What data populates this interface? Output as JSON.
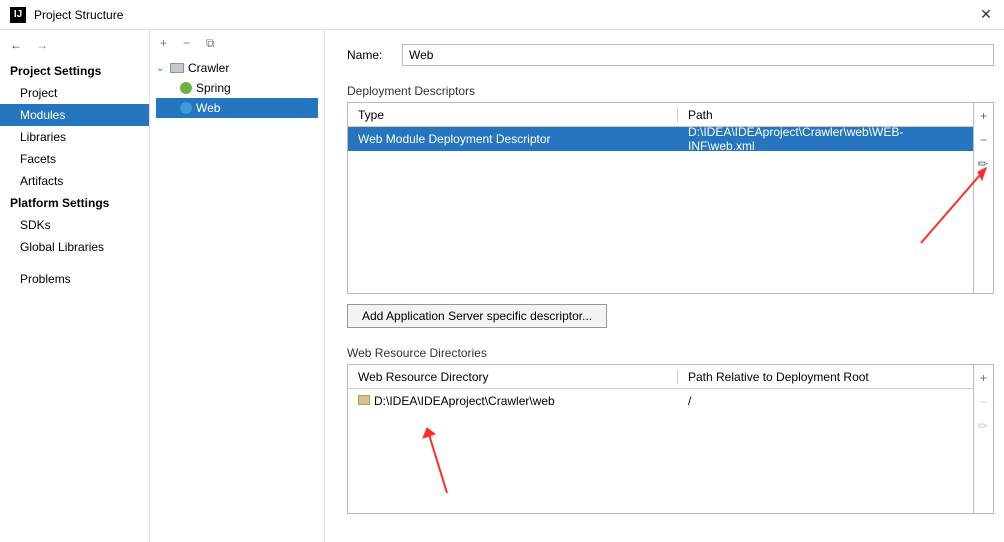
{
  "window": {
    "title": "Project Structure"
  },
  "sidebar": {
    "section1": "Project Settings",
    "items1": [
      "Project",
      "Modules",
      "Libraries",
      "Facets",
      "Artifacts"
    ],
    "section2": "Platform Settings",
    "items2": [
      "SDKs",
      "Global Libraries"
    ],
    "problems": "Problems"
  },
  "tree": {
    "root": "Crawler",
    "children": [
      "Spring",
      "Web"
    ]
  },
  "name_label": "Name:",
  "name_value": "Web",
  "dd": {
    "label": "Deployment Descriptors",
    "col_type": "Type",
    "col_path": "Path",
    "row_type": "Web Module Deployment Descriptor",
    "row_path": "D:\\IDEA\\IDEAproject\\Crawler\\web\\WEB-INF\\web.xml",
    "add_button": "Add Application Server specific descriptor..."
  },
  "wr": {
    "label": "Web Resource Directories",
    "col_dir": "Web Resource Directory",
    "col_rel": "Path Relative to Deployment Root",
    "row_dir": "D:\\IDEA\\IDEAproject\\Crawler\\web",
    "row_rel": "/"
  }
}
